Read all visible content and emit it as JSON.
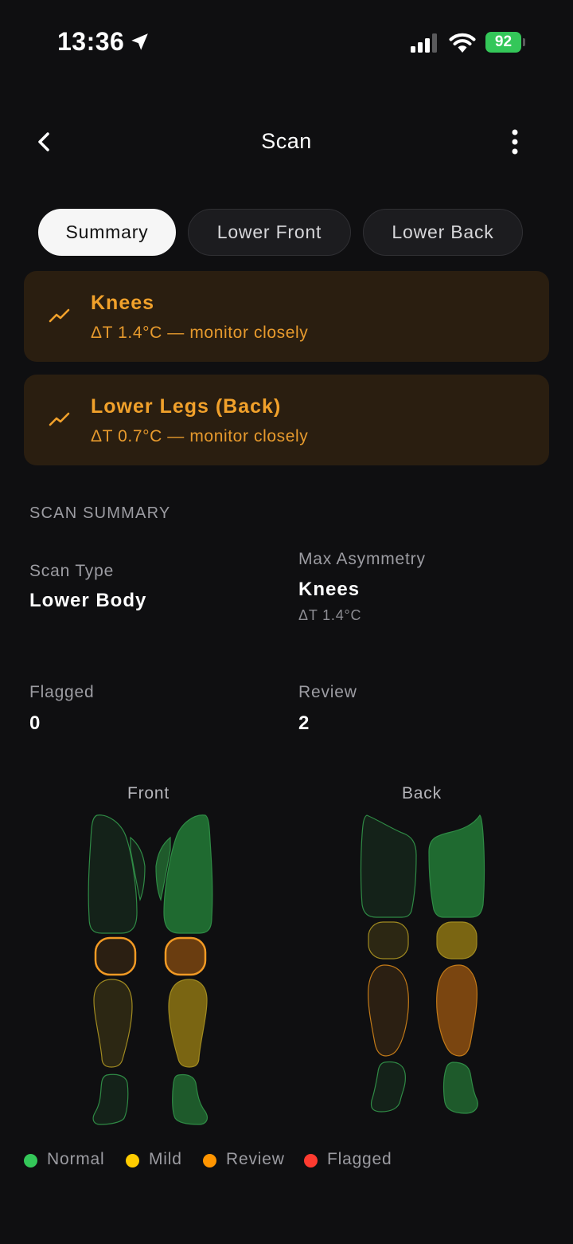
{
  "status_bar": {
    "time": "13:36",
    "battery": "92"
  },
  "nav": {
    "title": "Scan"
  },
  "tabs": [
    {
      "label": "Summary",
      "active": true
    },
    {
      "label": "Lower Front",
      "active": false
    },
    {
      "label": "Lower Back",
      "active": false
    }
  ],
  "alerts": [
    {
      "title": "Knees",
      "detail": "ΔT 1.4°C — monitor closely",
      "icon": "trend-icon"
    },
    {
      "title": "Lower Legs (Back)",
      "detail": "ΔT 0.7°C — monitor closely",
      "icon": "trend-icon"
    }
  ],
  "summary": {
    "header": "SCAN SUMMARY",
    "scan_type_label": "Scan Type",
    "scan_type_value": "Lower Body",
    "max_asym_label": "Max Asymmetry",
    "max_asym_value": "Knees",
    "max_asym_delta": "ΔT 1.4°C",
    "flagged_label": "Flagged",
    "flagged_value": "0",
    "review_label": "Review",
    "review_value": "2"
  },
  "body_views": {
    "front_label": "Front",
    "back_label": "Back"
  },
  "legend": [
    {
      "label": "Normal",
      "color": "#34c759"
    },
    {
      "label": "Mild",
      "color": "#ffcc00"
    },
    {
      "label": "Review",
      "color": "#ff9500"
    },
    {
      "label": "Flagged",
      "color": "#ff3b30"
    }
  ],
  "colors": {
    "accent_orange": "#f1a12b",
    "card_bg": "#2a1e10",
    "background": "#0f0f11"
  }
}
